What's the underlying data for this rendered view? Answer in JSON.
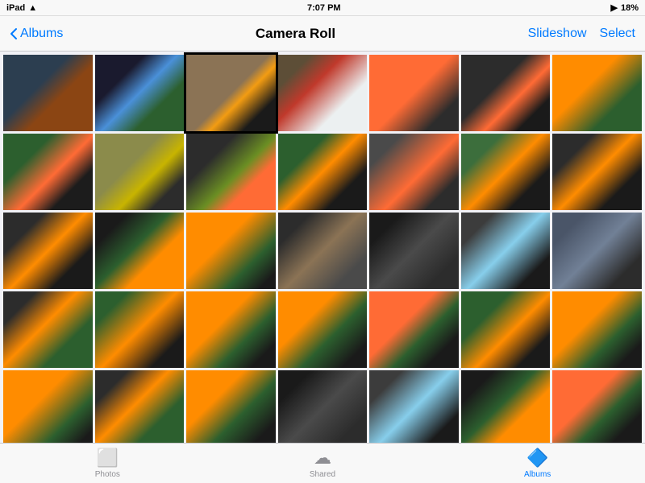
{
  "statusBar": {
    "carrier": "iPad",
    "wifi": "wifi",
    "time": "7:07 PM",
    "battery": "18%",
    "batteryIcon": "🔋"
  },
  "navBar": {
    "backLabel": "Albums",
    "title": "Camera Roll",
    "slideshowLabel": "Slideshow",
    "selectLabel": "Select"
  },
  "tabs": [
    {
      "id": "photos",
      "label": "Photos",
      "active": false
    },
    {
      "id": "shared",
      "label": "Shared",
      "active": false
    },
    {
      "id": "albums",
      "label": "Albums",
      "active": true
    }
  ],
  "grid": {
    "rows": [
      [
        {
          "id": 1,
          "cls": "p1"
        },
        {
          "id": 2,
          "cls": "p2"
        },
        {
          "id": 3,
          "cls": "p3",
          "selected": true
        },
        {
          "id": 4,
          "cls": "p4"
        },
        {
          "id": 5,
          "cls": "p5"
        },
        {
          "id": 6,
          "cls": "p6"
        },
        {
          "id": 7,
          "cls": "p7"
        }
      ],
      [
        {
          "id": 8,
          "cls": "p8"
        },
        {
          "id": 9,
          "cls": "p9"
        },
        {
          "id": 10,
          "cls": "p10"
        },
        {
          "id": 11,
          "cls": "p11"
        },
        {
          "id": 12,
          "cls": "p12"
        },
        {
          "id": 13,
          "cls": "p13"
        },
        {
          "id": 14,
          "cls": "p14"
        }
      ],
      [
        {
          "id": 15,
          "cls": "p15"
        },
        {
          "id": 16,
          "cls": "p16"
        },
        {
          "id": 17,
          "cls": "p17"
        },
        {
          "id": 18,
          "cls": "p18"
        },
        {
          "id": 19,
          "cls": "p19"
        },
        {
          "id": 20,
          "cls": "p20"
        },
        {
          "id": 21,
          "cls": "p21"
        }
      ],
      [
        {
          "id": 22,
          "cls": "p22"
        },
        {
          "id": 23,
          "cls": "p23"
        },
        {
          "id": 24,
          "cls": "p24"
        },
        {
          "id": 25,
          "cls": "p25"
        },
        {
          "id": 26,
          "cls": "p26"
        },
        {
          "id": 27,
          "cls": "p27"
        },
        {
          "id": 28,
          "cls": "p28"
        }
      ],
      [
        {
          "id": 29,
          "cls": "p17"
        },
        {
          "id": 30,
          "cls": "p22"
        },
        {
          "id": 31,
          "cls": "p25"
        },
        {
          "id": 32,
          "cls": "p19"
        },
        {
          "id": 33,
          "cls": "p20"
        },
        {
          "id": 34,
          "cls": "p16"
        },
        {
          "id": 35,
          "cls": "p26"
        }
      ]
    ]
  }
}
